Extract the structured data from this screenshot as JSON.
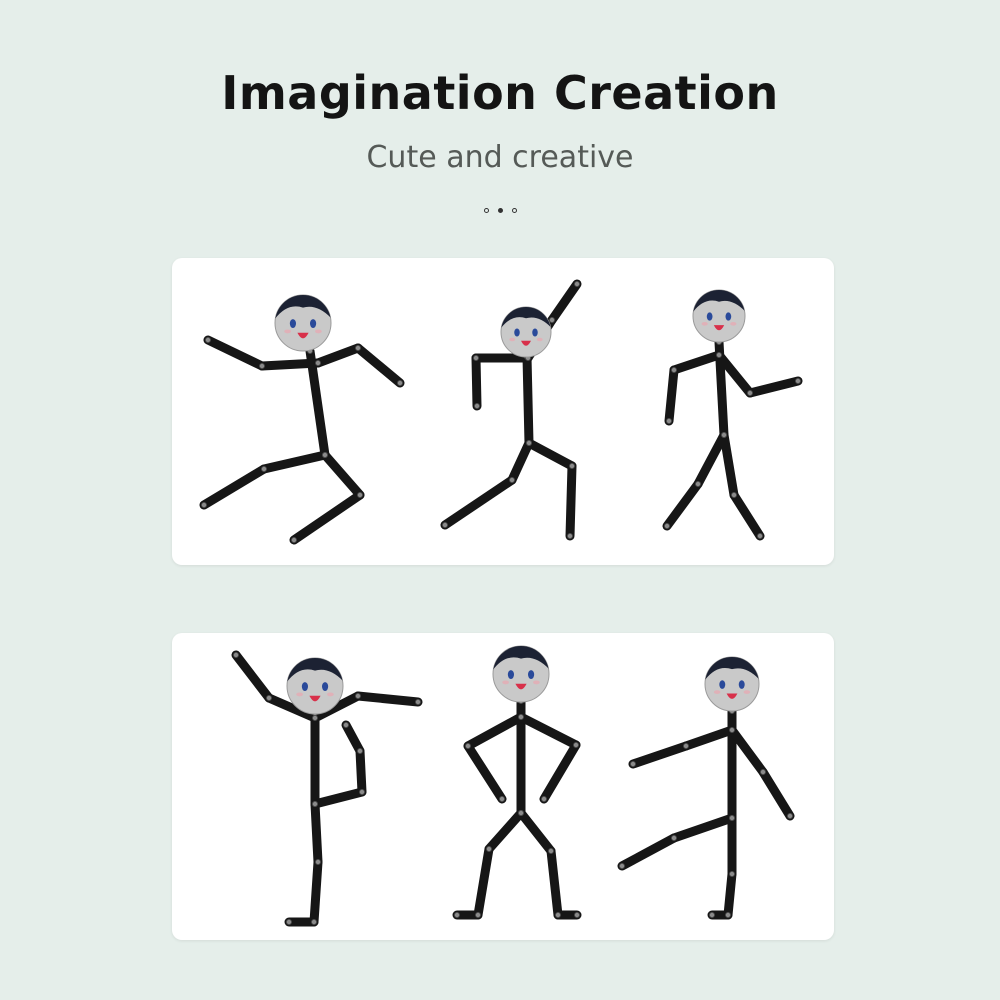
{
  "title": "Imagination Creation",
  "subtitle": "Cute and creative",
  "carousel": {
    "count": 3,
    "active_index": 1
  },
  "colors": {
    "background": "#e5eeea",
    "panel": "#ffffff",
    "stick": "#161616",
    "joint": "#8a8a8a",
    "head": "#c9c9c9",
    "hair": "#1c2233",
    "eye": "#2a4a9a",
    "mouth": "#d8304a"
  }
}
